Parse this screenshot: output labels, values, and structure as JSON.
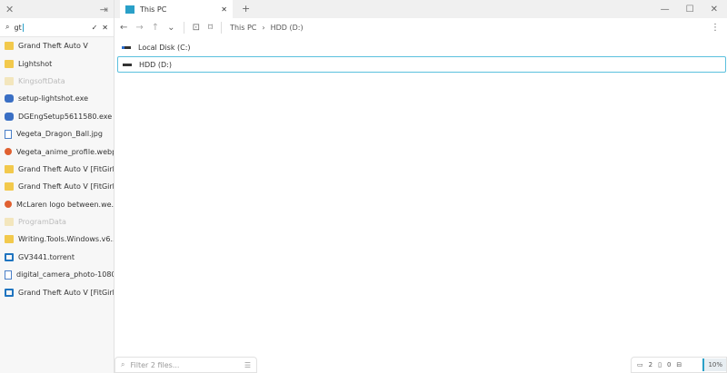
{
  "sidebar": {
    "search_value": "gt",
    "results": [
      {
        "name": "Grand Theft Auto V",
        "icon": "folder"
      },
      {
        "name": "Lightshot",
        "icon": "folder"
      },
      {
        "name": "KingsoftData",
        "icon": "folder-dim"
      },
      {
        "name": "setup-lightshot.exe",
        "icon": "exe"
      },
      {
        "name": "DGEngSetup5611580.exe",
        "icon": "exe"
      },
      {
        "name": "Vegeta_Dragon_Ball.jpg",
        "icon": "file"
      },
      {
        "name": "Vegeta_anime_profile.webp",
        "icon": "img"
      },
      {
        "name": "Grand Theft Auto V [FitGirl...",
        "icon": "folder"
      },
      {
        "name": "Grand Theft Auto V [FitGirl...",
        "icon": "folder"
      },
      {
        "name": "McLaren logo between.we...",
        "icon": "img"
      },
      {
        "name": "ProgramData",
        "icon": "folder-dim"
      },
      {
        "name": "Writing.Tools.Windows.v6....",
        "icon": "folder"
      },
      {
        "name": "GV3441.torrent",
        "icon": "tor"
      },
      {
        "name": "digital_camera_photo-1080...",
        "icon": "file"
      },
      {
        "name": "Grand Theft Auto V [FitGirl...",
        "icon": "tor"
      }
    ]
  },
  "tab": {
    "title": "This PC"
  },
  "breadcrumb": [
    "This PC",
    "HDD (D:)"
  ],
  "drives": [
    {
      "name": "Local Disk (C:)"
    },
    {
      "name": "HDD (D:)",
      "selected": true
    }
  ],
  "footer": {
    "filter_placeholder": "Filter 2 files...",
    "folders": "2",
    "files": "0",
    "zoom": "10%"
  },
  "accent": "#2aa0c8"
}
